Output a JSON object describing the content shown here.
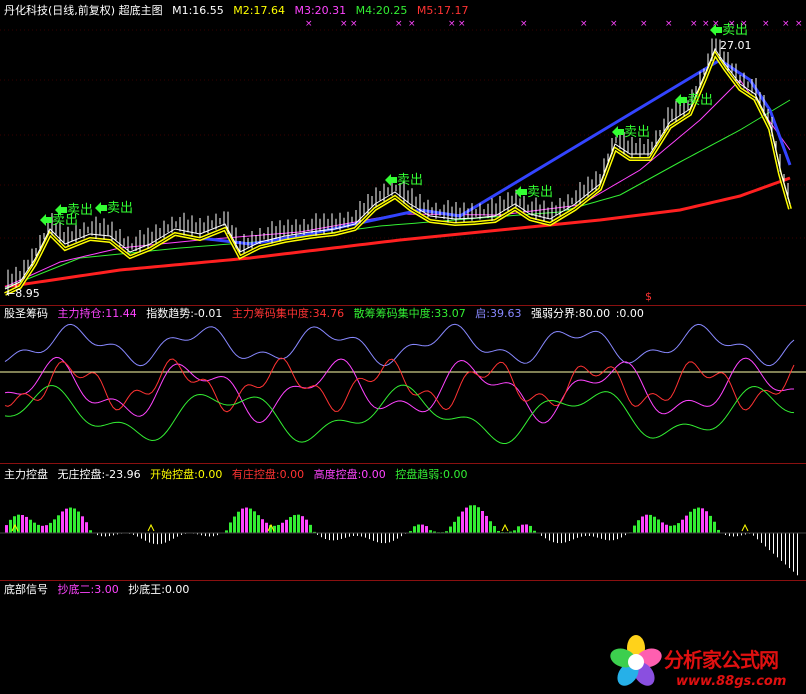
{
  "main_panel": {
    "title": "丹化科技(日线,前复权) 超底主图",
    "ma": [
      {
        "label": "M1:16.55",
        "color": "#ffffff"
      },
      {
        "label": "M2:17.64",
        "color": "#ffff00"
      },
      {
        "label": "M3:20.31",
        "color": "#ff44ff"
      },
      {
        "label": "M4:20.25",
        "color": "#33ee33"
      },
      {
        "label": "M5:17.17",
        "color": "#ff3333"
      }
    ],
    "high_label": "27.01",
    "low_label": "←8.95",
    "sell_label": "卖出",
    "dollar_mark": "$"
  },
  "chip_panel": {
    "title": "股圣筹码",
    "items": [
      {
        "label": "主力持仓:11.44",
        "color": "#ff44ff"
      },
      {
        "label": "指数趋势:-0.01",
        "color": "#ffffff"
      },
      {
        "label": "主力筹码集中度:34.76",
        "color": "#ff3333"
      },
      {
        "label": "散筹筹码集中度:33.07",
        "color": "#33ee33"
      },
      {
        "label": "启:39.63",
        "color": "#8888ff"
      },
      {
        "label": "强弱分界:80.00",
        "color": "#ffffff"
      },
      {
        "label": ":0.00",
        "color": "#ffffff"
      }
    ]
  },
  "control_panel": {
    "title": "主力控盘",
    "items": [
      {
        "label": "无庄控盘:-23.96",
        "color": "#ffffff"
      },
      {
        "label": "开始控盘:0.00",
        "color": "#ffff00"
      },
      {
        "label": "有庄控盘:0.00",
        "color": "#ff3333"
      },
      {
        "label": "高度控盘:0.00",
        "color": "#ff44ff"
      },
      {
        "label": "控盘趋弱:0.00",
        "color": "#33ee33"
      }
    ]
  },
  "bottom_panel": {
    "title": "底部信号",
    "items": [
      {
        "label": "抄底二:3.00",
        "color": "#ff44ff"
      },
      {
        "label": "抄底王:0.00",
        "color": "#ffffff"
      }
    ]
  },
  "watermark": {
    "title": "分析家公式网",
    "url": "www.88gs.com"
  },
  "colors": {
    "background": "#000000",
    "divider": "#8a1010",
    "ma_white": "#ffffff",
    "ma_yellow": "#ffff00",
    "ma_magenta": "#ff44ff",
    "ma_green": "#33ee33",
    "ma_red": "#ff2020",
    "ma_blue": "#3344ff",
    "sell_green": "#33ff33"
  }
}
